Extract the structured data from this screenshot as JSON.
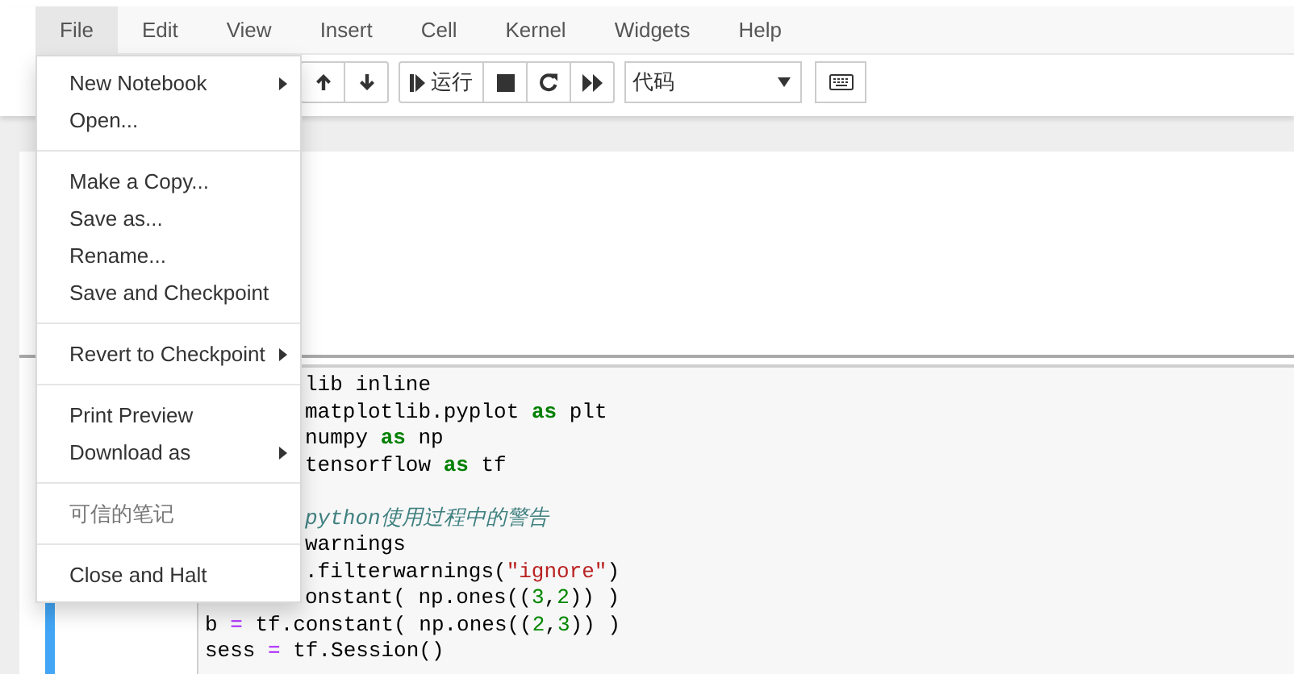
{
  "menubar": [
    {
      "label": "File",
      "selected": true
    },
    {
      "label": "Edit",
      "selected": false
    },
    {
      "label": "View",
      "selected": false
    },
    {
      "label": "Insert",
      "selected": false
    },
    {
      "label": "Cell",
      "selected": false
    },
    {
      "label": "Kernel",
      "selected": false
    },
    {
      "label": "Widgets",
      "selected": false
    },
    {
      "label": "Help",
      "selected": false
    }
  ],
  "file_menu": [
    {
      "kind": "submenu",
      "label": "New Notebook"
    },
    {
      "kind": "item",
      "label": "Open..."
    },
    {
      "kind": "divider"
    },
    {
      "kind": "item",
      "label": "Make a Copy..."
    },
    {
      "kind": "item",
      "label": "Save as..."
    },
    {
      "kind": "item",
      "label": "Rename..."
    },
    {
      "kind": "item",
      "label": "Save and Checkpoint"
    },
    {
      "kind": "divider"
    },
    {
      "kind": "submenu",
      "label": "Revert to Checkpoint"
    },
    {
      "kind": "divider"
    },
    {
      "kind": "item",
      "label": "Print Preview"
    },
    {
      "kind": "submenu",
      "label": "Download as"
    },
    {
      "kind": "divider"
    },
    {
      "kind": "disabled",
      "label": "可信的笔记"
    },
    {
      "kind": "divider"
    },
    {
      "kind": "item",
      "label": "Close and Halt"
    }
  ],
  "toolbar": {
    "groups": [
      [
        {
          "kind": "up"
        },
        {
          "kind": "down"
        }
      ],
      [
        {
          "kind": "run",
          "label": "运行"
        },
        {
          "kind": "stop"
        },
        {
          "kind": "restart"
        },
        {
          "kind": "fastforward"
        }
      ]
    ],
    "cell_type": "代码",
    "keyboard": {
      "kind": "keyboard"
    }
  },
  "cell": {
    "selected": true,
    "lines": [
      {
        "kind": "covered",
        "tokens": [
          {
            "text": "lib inline",
            "kind": "plain"
          }
        ]
      },
      {
        "kind": "covered",
        "tokens": [
          {
            "text": "matplotlib.pyplot ",
            "kind": "plain"
          },
          {
            "text": "as",
            "kind": "keyword"
          },
          {
            "text": " plt",
            "kind": "plain"
          }
        ]
      },
      {
        "kind": "covered",
        "tokens": [
          {
            "text": "numpy ",
            "kind": "plain"
          },
          {
            "text": "as",
            "kind": "keyword"
          },
          {
            "text": " np",
            "kind": "plain"
          }
        ]
      },
      {
        "kind": "covered",
        "tokens": [
          {
            "text": "tensorflow ",
            "kind": "plain"
          },
          {
            "text": "as",
            "kind": "keyword"
          },
          {
            "text": " tf",
            "kind": "plain"
          }
        ]
      },
      {
        "kind": "blank"
      },
      {
        "kind": "covered",
        "tokens": [
          {
            "text": "python使用过程中的警告",
            "kind": "comment"
          }
        ]
      },
      {
        "kind": "covered",
        "tokens": [
          {
            "text": "warnings",
            "kind": "plain"
          }
        ]
      },
      {
        "kind": "covered",
        "tokens": [
          {
            "text": ".filterwarnings(",
            "kind": "plain"
          },
          {
            "text": "\"ignore\"",
            "kind": "string"
          },
          {
            "text": ")",
            "kind": "plain"
          }
        ]
      },
      {
        "kind": "covered",
        "tokens": [
          {
            "text": "onstant( np.ones((",
            "kind": "plain"
          },
          {
            "text": "3",
            "kind": "number"
          },
          {
            "text": ",",
            "kind": "plain"
          },
          {
            "text": "2",
            "kind": "number"
          },
          {
            "text": ")) )",
            "kind": "plain"
          }
        ]
      },
      {
        "kind": "full",
        "tokens": [
          {
            "text": "b ",
            "kind": "plain"
          },
          {
            "text": "=",
            "kind": "operator"
          },
          {
            "text": " tf.constant( np.ones((",
            "kind": "plain"
          },
          {
            "text": "2",
            "kind": "number"
          },
          {
            "text": ",",
            "kind": "plain"
          },
          {
            "text": "3",
            "kind": "number"
          },
          {
            "text": ")) )",
            "kind": "plain"
          }
        ]
      },
      {
        "kind": "full",
        "tokens": [
          {
            "text": "sess ",
            "kind": "plain"
          },
          {
            "text": "=",
            "kind": "operator"
          },
          {
            "text": " tf.Session()",
            "kind": "plain"
          }
        ]
      }
    ]
  }
}
